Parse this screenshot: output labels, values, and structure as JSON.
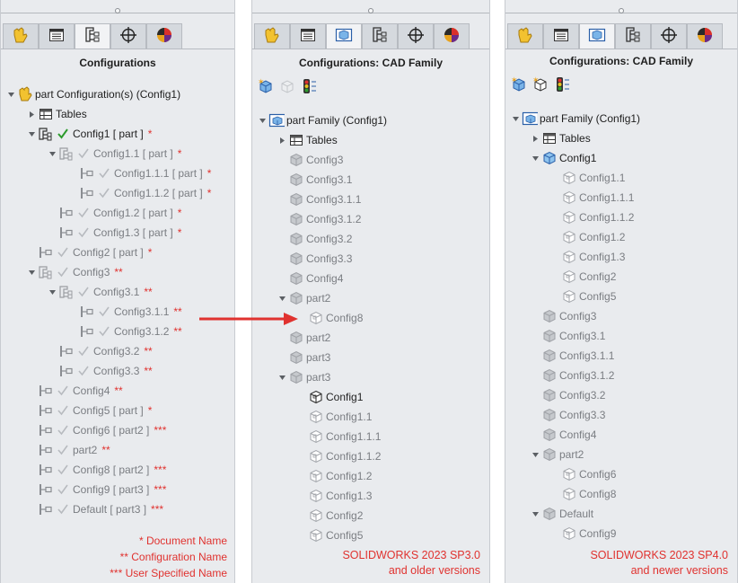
{
  "colors": {
    "accent_red": "#e0322f",
    "check_green": "#2d9b2d",
    "dim_text": "#7a7d82",
    "panel_bg": "#e9ebee"
  },
  "tab_icons": [
    "feature-manager-icon",
    "property-manager-icon",
    "configuration-manager-icon",
    "dimxpert-icon",
    "display-manager-icon"
  ],
  "left": {
    "title": "Configurations",
    "tree": [
      {
        "label": "part Configuration(s)  (Config1)",
        "mark": "",
        "icon": "part",
        "indent": 0,
        "arrow": "down",
        "check": "none",
        "dim": false
      },
      {
        "label": "Tables",
        "mark": "",
        "icon": "table",
        "indent": 1,
        "arrow": "right",
        "check": "none",
        "dim": false
      },
      {
        "label": "Config1 [ part ]",
        "mark": "*",
        "icon": "cfgtree",
        "indent": 1,
        "arrow": "down",
        "check": "green",
        "dim": false
      },
      {
        "label": "Config1.1 [ part ]",
        "mark": "*",
        "icon": "cfgtree",
        "indent": 2,
        "arrow": "down",
        "check": "grey",
        "dim": true
      },
      {
        "label": "Config1.1.1 [ part ]",
        "mark": "*",
        "icon": "cfgleaf",
        "indent": 3,
        "arrow": "none",
        "check": "grey",
        "dim": true
      },
      {
        "label": "Config1.1.2 [ part ]",
        "mark": "*",
        "icon": "cfgleaf",
        "indent": 3,
        "arrow": "none",
        "check": "grey",
        "dim": true
      },
      {
        "label": "Config1.2 [ part ]",
        "mark": "*",
        "icon": "cfgleaf",
        "indent": 2,
        "arrow": "none",
        "check": "grey",
        "dim": true
      },
      {
        "label": "Config1.3 [ part ]",
        "mark": "*",
        "icon": "cfgleaf",
        "indent": 2,
        "arrow": "none",
        "check": "grey",
        "dim": true
      },
      {
        "label": "Config2 [ part ]",
        "mark": "*",
        "icon": "cfgleaf",
        "indent": 1,
        "arrow": "none",
        "check": "grey",
        "dim": true
      },
      {
        "label": "Config3",
        "mark": "**",
        "icon": "cfgtree",
        "indent": 1,
        "arrow": "down",
        "check": "grey",
        "dim": true
      },
      {
        "label": "Config3.1",
        "mark": "**",
        "icon": "cfgtree",
        "indent": 2,
        "arrow": "down",
        "check": "grey",
        "dim": true
      },
      {
        "label": "Config3.1.1",
        "mark": "**",
        "icon": "cfgleaf",
        "indent": 3,
        "arrow": "none",
        "check": "grey",
        "dim": true
      },
      {
        "label": "Config3.1.2",
        "mark": "**",
        "icon": "cfgleaf",
        "indent": 3,
        "arrow": "none",
        "check": "grey",
        "dim": true
      },
      {
        "label": "Config3.2",
        "mark": "**",
        "icon": "cfgleaf",
        "indent": 2,
        "arrow": "none",
        "check": "grey",
        "dim": true
      },
      {
        "label": "Config3.3",
        "mark": "**",
        "icon": "cfgleaf",
        "indent": 2,
        "arrow": "none",
        "check": "grey",
        "dim": true
      },
      {
        "label": "Config4",
        "mark": "**",
        "icon": "cfgleaf",
        "indent": 1,
        "arrow": "none",
        "check": "grey",
        "dim": true
      },
      {
        "label": "Config5 [ part ]",
        "mark": "*",
        "icon": "cfgleaf",
        "indent": 1,
        "arrow": "none",
        "check": "grey",
        "dim": true
      },
      {
        "label": "Config6 [ part2 ]",
        "mark": "***",
        "icon": "cfgleaf",
        "indent": 1,
        "arrow": "none",
        "check": "grey",
        "dim": true
      },
      {
        "label": "part2",
        "mark": "**",
        "icon": "cfgleaf",
        "indent": 1,
        "arrow": "none",
        "check": "grey",
        "dim": true
      },
      {
        "label": "Config8 [ part2 ]",
        "mark": "***",
        "icon": "cfgleaf",
        "indent": 1,
        "arrow": "none",
        "check": "grey",
        "dim": true
      },
      {
        "label": "Config9 [ part3 ]",
        "mark": "***",
        "icon": "cfgleaf",
        "indent": 1,
        "arrow": "none",
        "check": "grey",
        "dim": true
      },
      {
        "label": "Default [ part3 ]",
        "mark": "***",
        "icon": "cfgleaf",
        "indent": 1,
        "arrow": "none",
        "check": "grey",
        "dim": true
      }
    ],
    "notes": [
      "* Document Name",
      "** Configuration Name",
      "*** User Specified Name"
    ]
  },
  "middle": {
    "title": "Configurations: CAD Family",
    "toolbar": [
      "add-derived-icon",
      "cube-disabled-icon",
      "traffic-light-icon"
    ],
    "tree": [
      {
        "label": "part Family  (Config1)",
        "icon": "family",
        "indent": 0,
        "arrow": "down",
        "dim": false
      },
      {
        "label": "Tables",
        "icon": "table",
        "indent": 1,
        "arrow": "right",
        "dim": false
      },
      {
        "label": "Config3",
        "icon": "cube-grey",
        "indent": 1,
        "arrow": "none",
        "dim": true
      },
      {
        "label": "Config3.1",
        "icon": "cube-grey",
        "indent": 1,
        "arrow": "none",
        "dim": true
      },
      {
        "label": "Config3.1.1",
        "icon": "cube-grey",
        "indent": 1,
        "arrow": "none",
        "dim": true
      },
      {
        "label": "Config3.1.2",
        "icon": "cube-grey",
        "indent": 1,
        "arrow": "none",
        "dim": true
      },
      {
        "label": "Config3.2",
        "icon": "cube-grey",
        "indent": 1,
        "arrow": "none",
        "dim": true
      },
      {
        "label": "Config3.3",
        "icon": "cube-grey",
        "indent": 1,
        "arrow": "none",
        "dim": true
      },
      {
        "label": "Config4",
        "icon": "cube-grey",
        "indent": 1,
        "arrow": "none",
        "dim": true
      },
      {
        "label": "part2",
        "icon": "cube-grey",
        "indent": 1,
        "arrow": "down",
        "dim": true
      },
      {
        "label": "Config8",
        "icon": "cube-outline",
        "indent": 2,
        "arrow": "none",
        "dim": true
      },
      {
        "label": "part2",
        "icon": "cube-grey",
        "indent": 1,
        "arrow": "none",
        "dim": true
      },
      {
        "label": "part3",
        "icon": "cube-grey",
        "indent": 1,
        "arrow": "none",
        "dim": true
      },
      {
        "label": "part3",
        "icon": "cube-grey",
        "indent": 1,
        "arrow": "down",
        "dim": true
      },
      {
        "label": "Config1",
        "icon": "cube-outline-dark",
        "indent": 2,
        "arrow": "none",
        "dim": false
      },
      {
        "label": "Config1.1",
        "icon": "cube-outline",
        "indent": 2,
        "arrow": "none",
        "dim": true
      },
      {
        "label": "Config1.1.1",
        "icon": "cube-outline",
        "indent": 2,
        "arrow": "none",
        "dim": true
      },
      {
        "label": "Config1.1.2",
        "icon": "cube-outline",
        "indent": 2,
        "arrow": "none",
        "dim": true
      },
      {
        "label": "Config1.2",
        "icon": "cube-outline",
        "indent": 2,
        "arrow": "none",
        "dim": true
      },
      {
        "label": "Config1.3",
        "icon": "cube-outline",
        "indent": 2,
        "arrow": "none",
        "dim": true
      },
      {
        "label": "Config2",
        "icon": "cube-outline",
        "indent": 2,
        "arrow": "none",
        "dim": true
      },
      {
        "label": "Config5",
        "icon": "cube-outline",
        "indent": 2,
        "arrow": "none",
        "dim": true
      }
    ],
    "caption": [
      "SOLIDWORKS 2023 SP3.0",
      "and older versions"
    ]
  },
  "right": {
    "title": "Configurations: CAD Family",
    "toolbar": [
      "add-derived-icon",
      "cube-outline-icon",
      "traffic-light-icon"
    ],
    "tree": [
      {
        "label": "part Family  (Config1)",
        "icon": "family",
        "indent": 0,
        "arrow": "down",
        "dim": false
      },
      {
        "label": "Tables",
        "icon": "table",
        "indent": 1,
        "arrow": "right",
        "dim": false
      },
      {
        "label": "Config1",
        "icon": "cube-blue",
        "indent": 1,
        "arrow": "down",
        "dim": false
      },
      {
        "label": "Config1.1",
        "icon": "cube-outline",
        "indent": 2,
        "arrow": "none",
        "dim": true
      },
      {
        "label": "Config1.1.1",
        "icon": "cube-outline",
        "indent": 2,
        "arrow": "none",
        "dim": true
      },
      {
        "label": "Config1.1.2",
        "icon": "cube-outline",
        "indent": 2,
        "arrow": "none",
        "dim": true
      },
      {
        "label": "Config1.2",
        "icon": "cube-outline",
        "indent": 2,
        "arrow": "none",
        "dim": true
      },
      {
        "label": "Config1.3",
        "icon": "cube-outline",
        "indent": 2,
        "arrow": "none",
        "dim": true
      },
      {
        "label": "Config2",
        "icon": "cube-outline",
        "indent": 2,
        "arrow": "none",
        "dim": true
      },
      {
        "label": "Config5",
        "icon": "cube-outline",
        "indent": 2,
        "arrow": "none",
        "dim": true
      },
      {
        "label": "Config3",
        "icon": "cube-grey",
        "indent": 1,
        "arrow": "none",
        "dim": true
      },
      {
        "label": "Config3.1",
        "icon": "cube-grey",
        "indent": 1,
        "arrow": "none",
        "dim": true
      },
      {
        "label": "Config3.1.1",
        "icon": "cube-grey",
        "indent": 1,
        "arrow": "none",
        "dim": true
      },
      {
        "label": "Config3.1.2",
        "icon": "cube-grey",
        "indent": 1,
        "arrow": "none",
        "dim": true
      },
      {
        "label": "Config3.2",
        "icon": "cube-grey",
        "indent": 1,
        "arrow": "none",
        "dim": true
      },
      {
        "label": "Config3.3",
        "icon": "cube-grey",
        "indent": 1,
        "arrow": "none",
        "dim": true
      },
      {
        "label": "Config4",
        "icon": "cube-grey",
        "indent": 1,
        "arrow": "none",
        "dim": true
      },
      {
        "label": "part2",
        "icon": "cube-grey",
        "indent": 1,
        "arrow": "down",
        "dim": true
      },
      {
        "label": "Config6",
        "icon": "cube-outline",
        "indent": 2,
        "arrow": "none",
        "dim": true
      },
      {
        "label": "Config8",
        "icon": "cube-outline",
        "indent": 2,
        "arrow": "none",
        "dim": true
      },
      {
        "label": "Default",
        "icon": "cube-grey",
        "indent": 1,
        "arrow": "down",
        "dim": true
      },
      {
        "label": "Config9",
        "icon": "cube-outline",
        "indent": 2,
        "arrow": "none",
        "dim": true
      }
    ],
    "caption": [
      "SOLIDWORKS 2023 SP4.0",
      "and newer versions"
    ]
  }
}
